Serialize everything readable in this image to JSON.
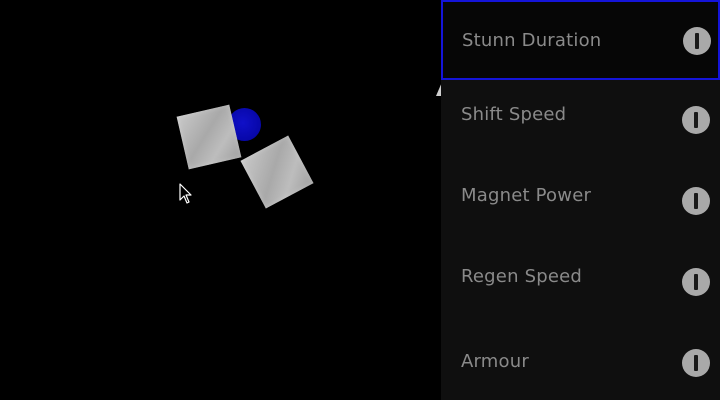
{
  "game": {
    "orb_color": "#0707a8",
    "crate_color": "#b5b5b5",
    "background_color": "#000000",
    "cursor_icon": "arrow-cursor-icon"
  },
  "upgrades": {
    "selected_index": 0,
    "highlight_color": "#1414d8",
    "items": [
      {
        "label": "Stunn Duration",
        "button_icon": "upgrade-bar-icon"
      },
      {
        "label": "Shift Speed",
        "button_icon": "upgrade-bar-icon"
      },
      {
        "label": "Magnet Power",
        "button_icon": "upgrade-bar-icon"
      },
      {
        "label": "Regen Speed",
        "button_icon": "upgrade-bar-icon"
      },
      {
        "label": "Armour",
        "button_icon": "upgrade-bar-icon"
      }
    ]
  }
}
